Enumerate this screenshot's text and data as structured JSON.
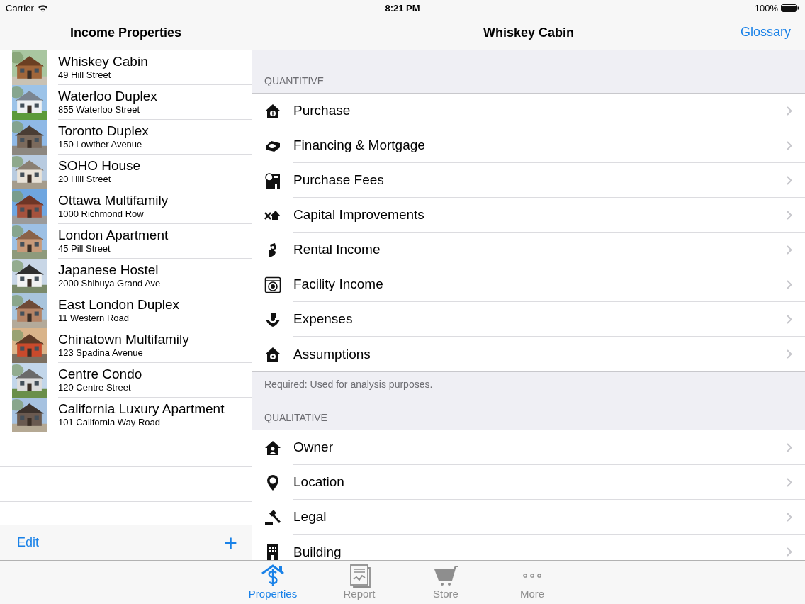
{
  "status_bar": {
    "carrier": "Carrier",
    "time": "8:21 PM",
    "battery": "100%"
  },
  "master": {
    "title": "Income Properties",
    "properties": [
      {
        "name": "Whiskey Cabin",
        "address": "49 Hill Street"
      },
      {
        "name": "Waterloo Duplex",
        "address": "855 Waterloo Street"
      },
      {
        "name": "Toronto Duplex",
        "address": "150 Lowther Avenue"
      },
      {
        "name": "SOHO House",
        "address": "20 Hill Street"
      },
      {
        "name": "Ottawa Multifamily",
        "address": "1000 Richmond Row"
      },
      {
        "name": "London Apartment",
        "address": "45 Pill Street"
      },
      {
        "name": "Japanese Hostel",
        "address": "2000 Shibuya Grand Ave"
      },
      {
        "name": "East London Duplex",
        "address": "11 Western Road"
      },
      {
        "name": "Chinatown Multifamily",
        "address": "123 Spadina Avenue"
      },
      {
        "name": "Centre Condo",
        "address": "120 Centre Street"
      },
      {
        "name": "California Luxury Apartment",
        "address": "101 California Way Road"
      }
    ],
    "toolbar": {
      "edit": "Edit",
      "add": "+"
    }
  },
  "detail": {
    "title": "Whiskey Cabin",
    "glossary": "Glossary",
    "sections": [
      {
        "header": "QUANTITIVE",
        "footer": "Required: Used for analysis purposes.",
        "items": [
          "Purchase",
          "Financing & Mortgage",
          "Purchase Fees",
          "Capital Improvements",
          "Rental Income",
          "Facility Income",
          "Expenses",
          "Assumptions"
        ]
      },
      {
        "header": "QUALITATIVE",
        "items": [
          "Owner",
          "Location",
          "Legal",
          "Building"
        ]
      }
    ]
  },
  "tab_bar": [
    {
      "label": "Properties",
      "selected": true
    },
    {
      "label": "Report",
      "selected": false
    },
    {
      "label": "Store",
      "selected": false
    },
    {
      "label": "More",
      "selected": false
    }
  ]
}
